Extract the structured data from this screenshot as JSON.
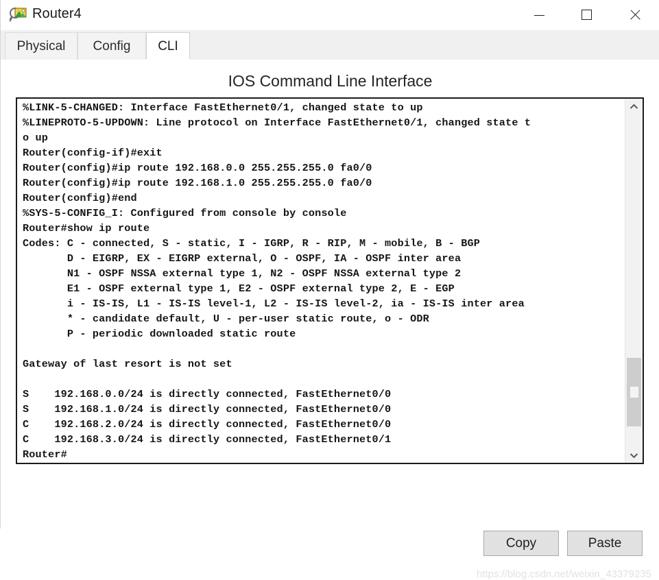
{
  "window": {
    "title": "Router4",
    "icon": "router-device-icon",
    "controls": {
      "minimize": "–",
      "maximize": "□",
      "close": "✕"
    }
  },
  "tabs": [
    {
      "label": "Physical",
      "active": false
    },
    {
      "label": "Config",
      "active": false
    },
    {
      "label": "CLI",
      "active": true
    }
  ],
  "panel": {
    "title": "IOS Command Line Interface"
  },
  "terminal": {
    "lines": [
      "%LINK-5-CHANGED: Interface FastEthernet0/1, changed state to up",
      "%LINEPROTO-5-UPDOWN: Line protocol on Interface FastEthernet0/1, changed state t",
      "o up",
      "Router(config-if)#exit",
      "Router(config)#ip route 192.168.0.0 255.255.255.0 fa0/0",
      "Router(config)#ip route 192.168.1.0 255.255.255.0 fa0/0",
      "Router(config)#end",
      "%SYS-5-CONFIG_I: Configured from console by console",
      "Router#show ip route",
      "Codes: C - connected, S - static, I - IGRP, R - RIP, M - mobile, B - BGP",
      "       D - EIGRP, EX - EIGRP external, O - OSPF, IA - OSPF inter area",
      "       N1 - OSPF NSSA external type 1, N2 - OSPF NSSA external type 2",
      "       E1 - OSPF external type 1, E2 - OSPF external type 2, E - EGP",
      "       i - IS-IS, L1 - IS-IS level-1, L2 - IS-IS level-2, ia - IS-IS inter area",
      "       * - candidate default, U - per-user static route, o - ODR",
      "       P - periodic downloaded static route",
      "",
      "Gateway of last resort is not set",
      "",
      "S    192.168.0.0/24 is directly connected, FastEthernet0/0",
      "S    192.168.1.0/24 is directly connected, FastEthernet0/0",
      "C    192.168.2.0/24 is directly connected, FastEthernet0/0",
      "C    192.168.3.0/24 is directly connected, FastEthernet0/1",
      "Router#"
    ]
  },
  "scrollbar": {
    "up_arrow": "⌃",
    "down_arrow": "⌄"
  },
  "buttons": {
    "copy": "Copy",
    "paste": "Paste"
  },
  "watermark": {
    "text": "https://blog.csdn.net/weixin_43379235"
  },
  "colors": {
    "title_text": "#1a1a1a",
    "terminal_text": "#161616",
    "tab_active_bg": "#ffffff",
    "tab_inactive_bg": "#f3f3f3",
    "button_bg": "#e1e1e1",
    "scrollbar_thumb": "#cdcdcd",
    "watermark": "#e2e2e2"
  }
}
